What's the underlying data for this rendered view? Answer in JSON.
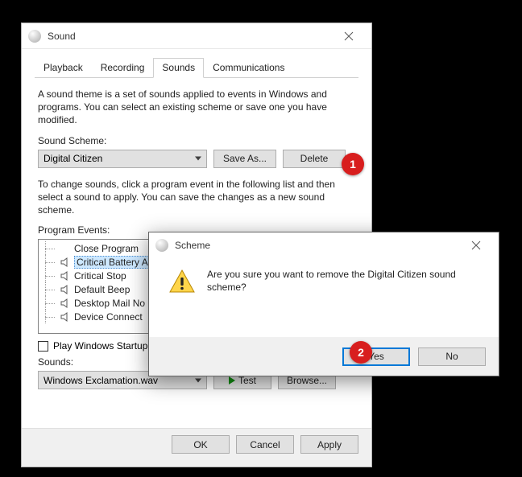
{
  "sound_dialog": {
    "title": "Sound",
    "tabs": [
      "Playback",
      "Recording",
      "Sounds",
      "Communications"
    ],
    "active_tab_index": 2,
    "theme_desc": "A sound theme is a set of sounds applied to events in Windows and programs.  You can select an existing scheme or save one you have modified.",
    "scheme_label": "Sound Scheme:",
    "scheme_value": "Digital Citizen",
    "save_as_label": "Save As...",
    "delete_label": "Delete",
    "change_desc": "To change sounds, click a program event in the following list and then select a sound to apply.  You can save the changes as a new sound scheme.",
    "events_label": "Program Events:",
    "events": [
      {
        "label": "Close Program",
        "has_sound": false
      },
      {
        "label": "Critical Battery Al",
        "has_sound": true,
        "selected": true
      },
      {
        "label": "Critical Stop",
        "has_sound": true
      },
      {
        "label": "Default Beep",
        "has_sound": true
      },
      {
        "label": "Desktop Mail No",
        "has_sound": true
      },
      {
        "label": "Device Connect",
        "has_sound": true
      }
    ],
    "startup_checkbox": "Play Windows Startup",
    "sounds_label": "Sounds:",
    "sounds_value": "Windows Exclamation.wav",
    "test_label": "Test",
    "browse_label": "Browse...",
    "ok_label": "OK",
    "cancel_label": "Cancel",
    "apply_label": "Apply"
  },
  "scheme_dialog": {
    "title": "Scheme",
    "message": "Are you sure you want to remove the Digital Citizen sound scheme?",
    "yes_label": "Yes",
    "no_label": "No"
  },
  "annotations": {
    "badge1": "1",
    "badge2": "2"
  }
}
